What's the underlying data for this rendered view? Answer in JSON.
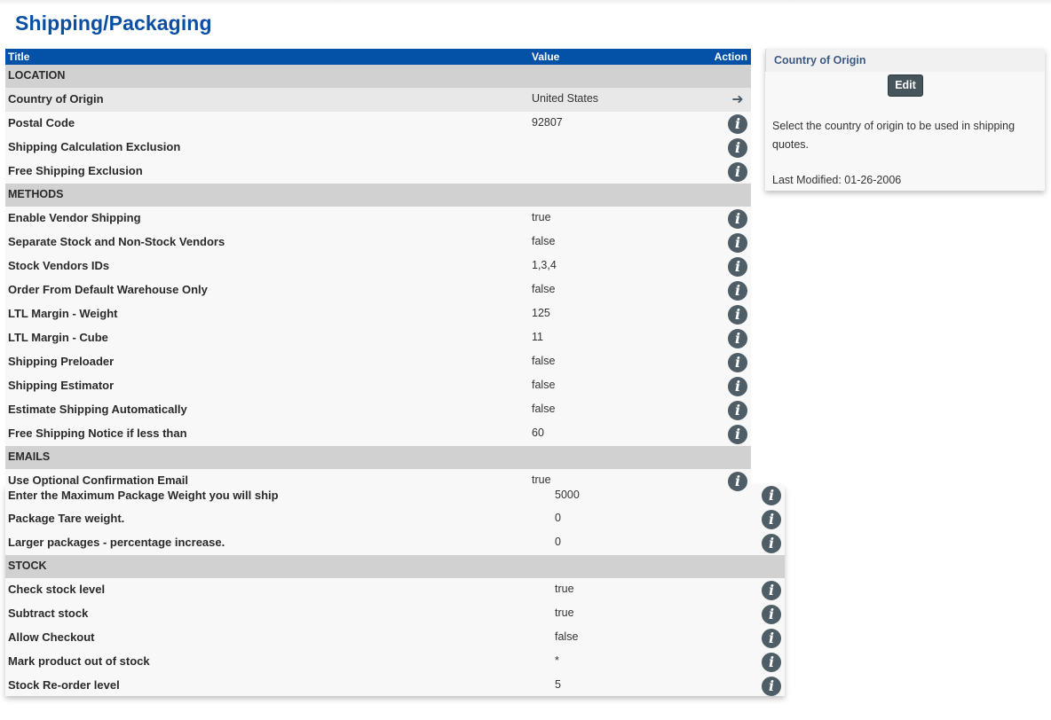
{
  "page": {
    "title": "Shipping/Packaging"
  },
  "table": {
    "headers": {
      "title": "Title",
      "value": "Value",
      "action": "Action"
    }
  },
  "location": {
    "label": "LOCATION",
    "rows": [
      {
        "title": "Country of Origin",
        "value": "United States",
        "action": "arrow-right-icon"
      },
      {
        "title": "Postal Code",
        "value": "92807",
        "action": "info-icon"
      },
      {
        "title": "Shipping Calculation Exclusion",
        "value": "",
        "action": "info-icon"
      },
      {
        "title": "Free Shipping Exclusion",
        "value": "",
        "action": "info-icon"
      }
    ]
  },
  "methods": {
    "label": "METHODS",
    "rows": [
      {
        "title": "Enable Vendor Shipping",
        "value": "true"
      },
      {
        "title": "Separate Stock and Non-Stock Vendors",
        "value": "false"
      },
      {
        "title": "Stock Vendors IDs",
        "value": "1,3,4"
      },
      {
        "title": "Order From Default Warehouse Only",
        "value": "false"
      },
      {
        "title": "LTL Margin - Weight",
        "value": "125"
      },
      {
        "title": "LTL Margin - Cube",
        "value": "11"
      },
      {
        "title": "Shipping Preloader",
        "value": "false"
      },
      {
        "title": "Shipping Estimator",
        "value": "false"
      },
      {
        "title": "Estimate Shipping Automatically",
        "value": "false"
      },
      {
        "title": "Free Shipping Notice if less than",
        "value": "60"
      }
    ]
  },
  "emails": {
    "label": "EMAILS",
    "rows": [
      {
        "title": "Use Optional Confirmation Email",
        "value": "true"
      }
    ]
  },
  "packaging": {
    "rows": [
      {
        "title": "Enter the Maximum Package Weight you will ship",
        "value": "5000"
      },
      {
        "title": "Package Tare weight.",
        "value": "0"
      },
      {
        "title": "Larger packages - percentage increase.",
        "value": "0"
      }
    ]
  },
  "stock": {
    "label": "STOCK",
    "rows": [
      {
        "title": "Check stock level",
        "value": "true"
      },
      {
        "title": "Subtract stock",
        "value": "true"
      },
      {
        "title": "Allow Checkout",
        "value": "false"
      },
      {
        "title": "Mark product out of stock",
        "value": "*"
      },
      {
        "title": "Stock Re-order level",
        "value": "5"
      }
    ]
  },
  "icons": {
    "info": "i",
    "arrow": "➜"
  },
  "card": {
    "title": "Country of Origin",
    "edit_label": "Edit",
    "description": "Select the country of origin to be used in shipping quotes.",
    "last_modified": "Last Modified: 01-26-2006"
  },
  "colors": {
    "header_blue": "#0451a8",
    "title_blue": "#0a4fa3",
    "icon_gray": "#4f5d66",
    "section_gray": "#d1d1d1"
  }
}
